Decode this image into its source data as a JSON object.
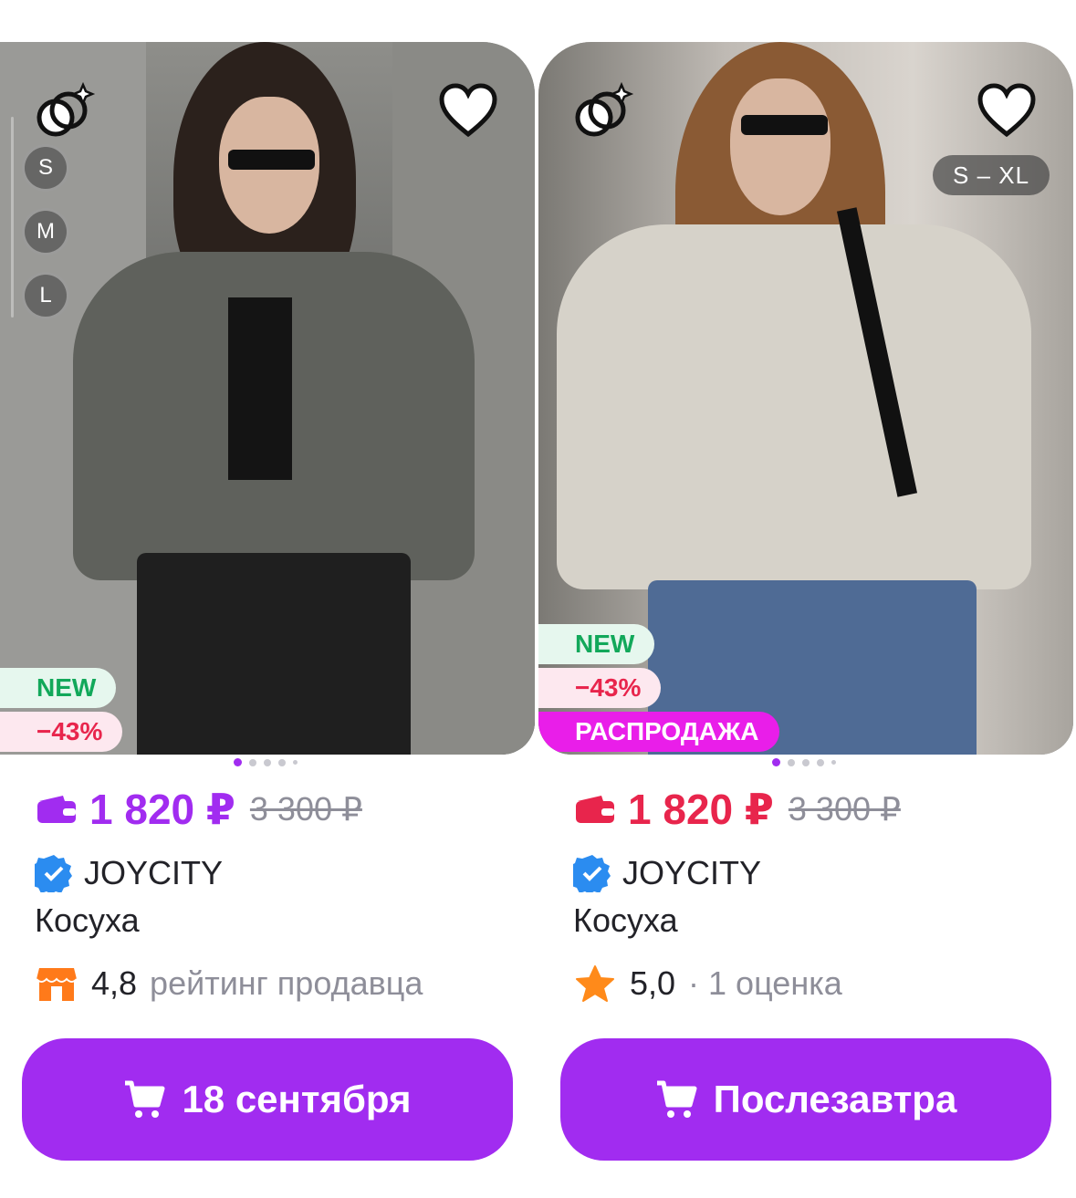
{
  "colors": {
    "accent": "#a12cf0",
    "red": "#e8254c",
    "new_green": "#12a85a",
    "sale_magenta": "#e91ee9",
    "muted": "#8e8e99"
  },
  "products": [
    {
      "image_alt": "Woman in grey cropped leather jacket",
      "sizes": [
        "S",
        "M",
        "L"
      ],
      "size_range": "",
      "badges": {
        "new": "NEW",
        "discount": "−43%",
        "sale": ""
      },
      "price": "1 820 ₽",
      "old_price": "3 300 ₽",
      "wallet_icon": "wallet-icon",
      "seller": "JOYCITY",
      "title": "Косуха",
      "rating_icon": "shop-icon",
      "rating_value": "4,8",
      "rating_text": "рейтинг продавца",
      "button_label": "18 сентября"
    },
    {
      "image_alt": "Woman in light beige leather biker jacket",
      "sizes": [],
      "size_range": "S – XL",
      "badges": {
        "new": "NEW",
        "discount": "−43%",
        "sale": "РАСПРОДАЖА"
      },
      "price": "1 820 ₽",
      "old_price": "3 300 ₽",
      "wallet_icon": "wallet-icon",
      "seller": "JOYCITY",
      "title": "Косуха",
      "rating_icon": "star-icon",
      "rating_value": "5,0",
      "rating_text": "· 1 оценка",
      "button_label": "Послезавтра"
    }
  ]
}
